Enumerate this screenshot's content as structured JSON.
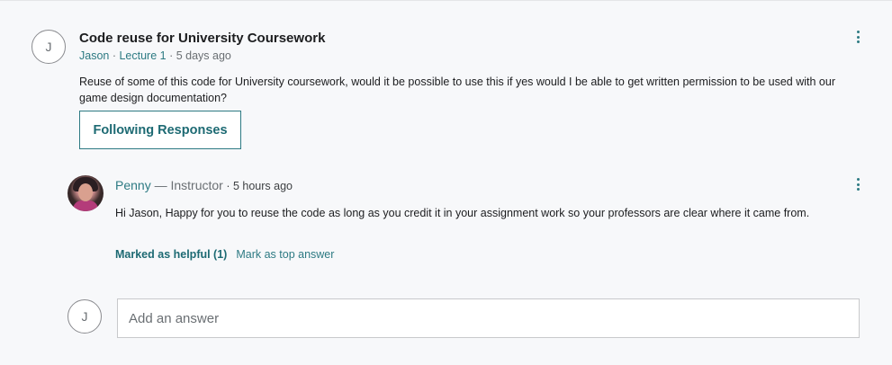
{
  "question": {
    "avatar_letter": "J",
    "title": "Code reuse for University Coursework",
    "author": "Jason",
    "separator1": " · ",
    "lecture": "Lecture 1",
    "separator2": " · ",
    "time": "5 days ago",
    "body": "Reuse of some of this code for University coursework, would it be possible to use this if yes would I be able to get written permission to be used with our game design documentation?",
    "follow_label": "Following Responses"
  },
  "answer": {
    "author": "Penny",
    "role": " — Instructor",
    "separator": " · ",
    "time": "5 hours ago",
    "body": "Hi Jason, Happy for you to reuse the code as long as you credit it in your assignment work so your professors are clear where it came from.",
    "helpful_label": "Marked as helpful (1)",
    "top_answer_label": "Mark as top answer"
  },
  "reply": {
    "avatar_letter": "J",
    "placeholder": "Add an answer"
  },
  "colors": {
    "accent": "#2d7a83",
    "text": "#1c1d1f",
    "muted": "#6a6f73"
  }
}
